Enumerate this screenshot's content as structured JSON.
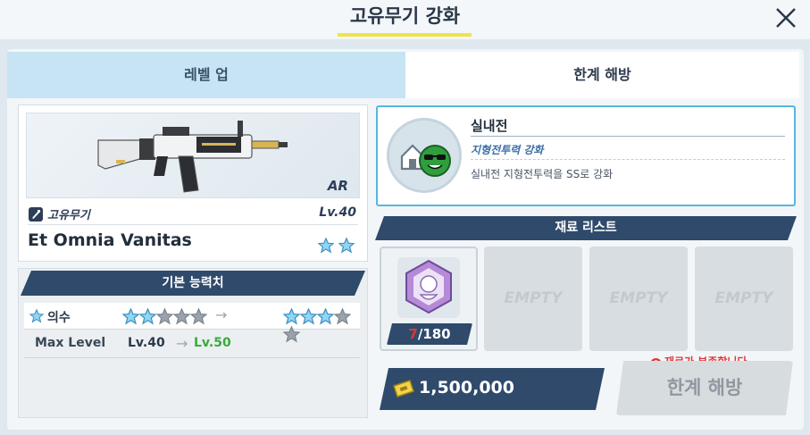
{
  "header": {
    "title": "고유무기 강화"
  },
  "tabs": [
    {
      "label": "레벨 업"
    },
    {
      "label": "한계 해방"
    }
  ],
  "weapon": {
    "type": "AR",
    "category_label": "고유무기",
    "level": "Lv.40",
    "name": "Et Omnia Vanitas",
    "star_count": 2
  },
  "stats": {
    "header": "기본 능력치",
    "rows": [
      {
        "label": "의수",
        "stars_before": 2,
        "stars_after": 3,
        "stars_total": 5
      },
      {
        "label": "Max Level",
        "before": "Lv.40",
        "after": "Lv.50"
      }
    ]
  },
  "skill": {
    "name": "실내전",
    "subtitle": "지형전투력 강화",
    "description": "실내전 지형전투력을 SS로 강화"
  },
  "materials": {
    "header": "재료 리스트",
    "items": [
      {
        "have": "7",
        "need": "/180"
      }
    ],
    "empty_label": "EMPTY"
  },
  "cost": {
    "value": "1,500,000"
  },
  "warning": "재료가 부족합니다.",
  "action_button": "한계 해방",
  "colors": {
    "navy": "#2f4a6b",
    "accent_blue": "#56b7e0",
    "warning_red": "#e03838",
    "title_underline": "#f1e24a"
  }
}
